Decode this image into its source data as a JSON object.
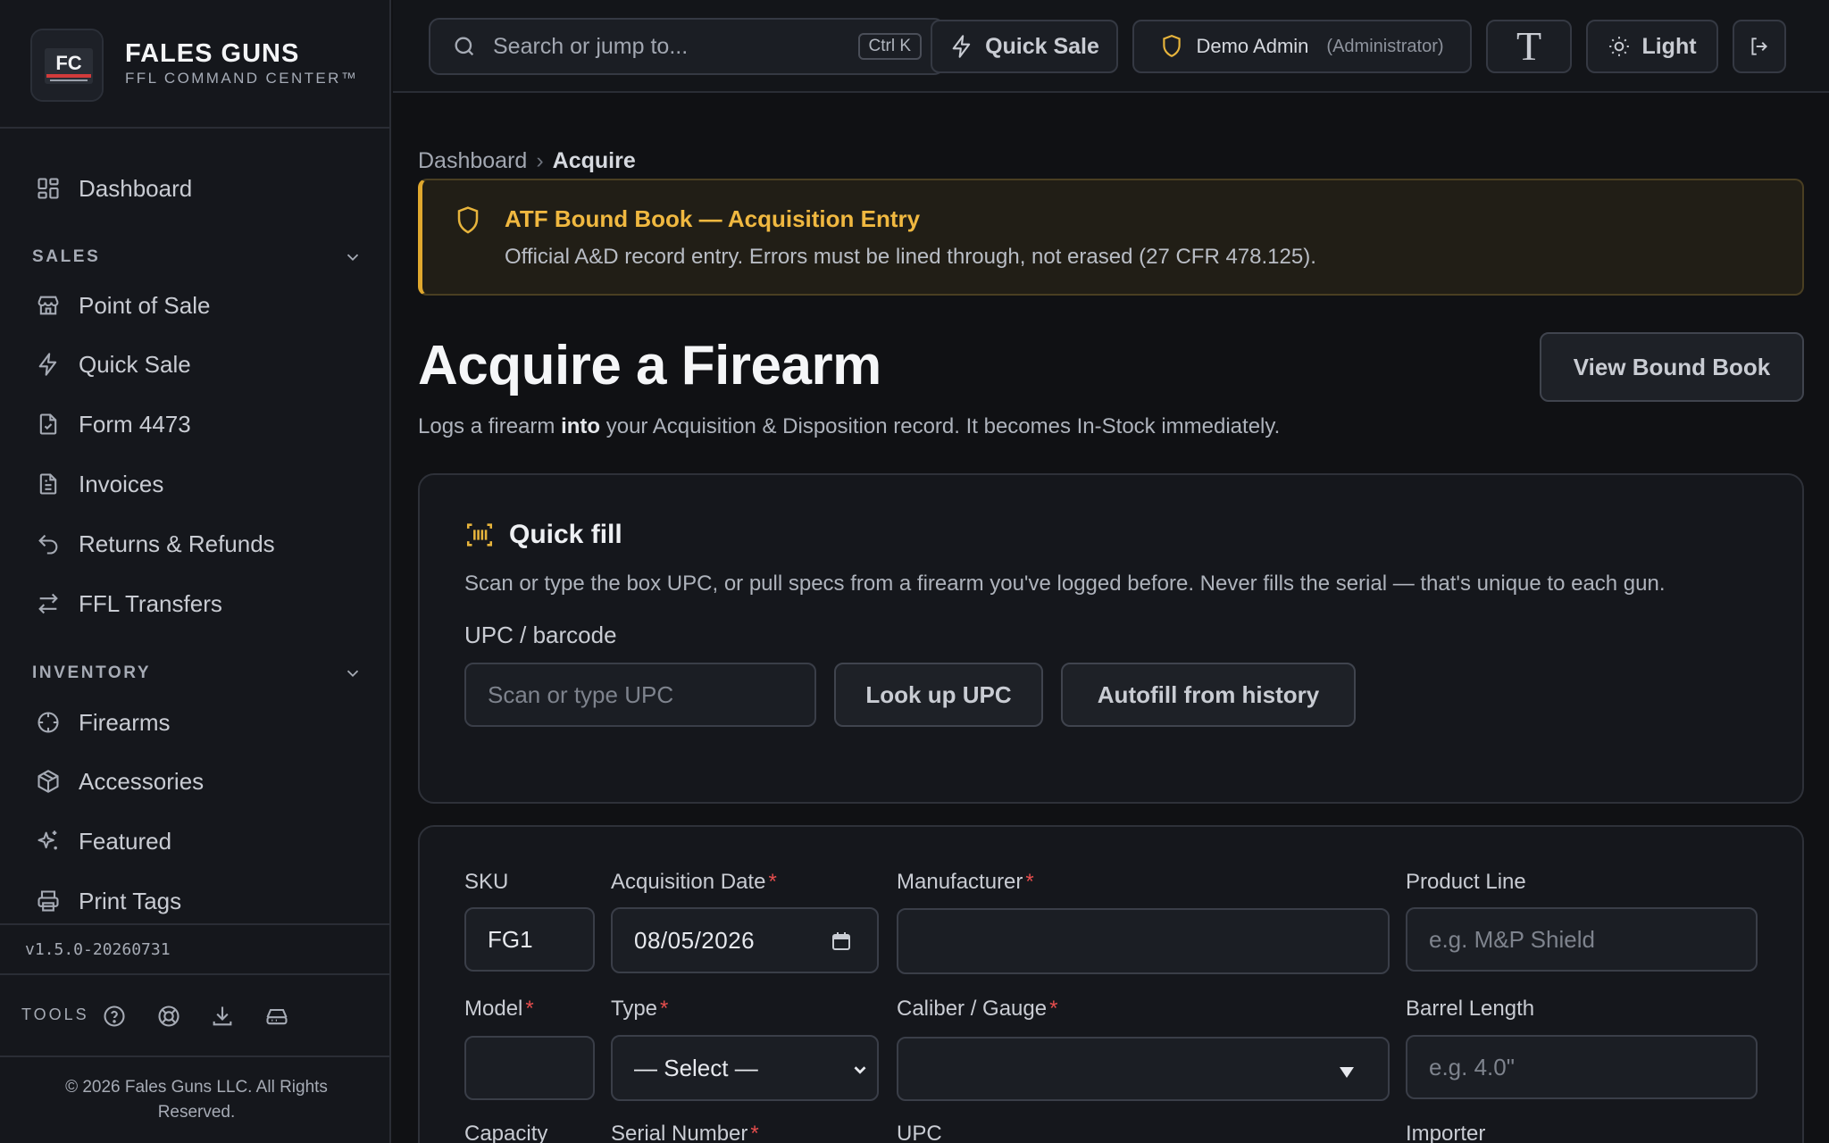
{
  "brand": {
    "title": "FALES GUNS",
    "subtitle": "FFL COMMAND CENTER™",
    "logo_text": "FC"
  },
  "sidebar": {
    "dashboard": "Dashboard",
    "sections": [
      {
        "label": "SALES",
        "items": [
          "Point of Sale",
          "Quick Sale",
          "Form 4473",
          "Invoices",
          "Returns & Refunds",
          "FFL Transfers"
        ]
      },
      {
        "label": "INVENTORY",
        "items": [
          "Firearms",
          "Accessories",
          "Featured",
          "Print Tags"
        ]
      }
    ],
    "version": "v1.5.0-20260731",
    "tools_label": "TOOLS",
    "copyright": "© 2026 Fales Guns LLC. All Rights Reserved."
  },
  "topbar": {
    "search_placeholder": "Search or jump to...",
    "search_shortcut": "Ctrl K",
    "quick_sale": "Quick Sale",
    "user_name": "Demo Admin",
    "user_role": "(Administrator)",
    "font_toggle": "T",
    "theme": "Light"
  },
  "breadcrumb": {
    "root": "Dashboard",
    "separator": "›",
    "current": "Acquire"
  },
  "notice": {
    "title": "ATF Bound Book — Acquisition Entry",
    "body": "Official A&D record entry. Errors must be lined through, not erased (27 CFR 478.125)."
  },
  "page": {
    "title": "Acquire a Firearm",
    "subtitle_pre": "Logs a firearm ",
    "subtitle_bold": "into",
    "subtitle_post": " your Acquisition & Disposition record. It becomes In-Stock immediately.",
    "view_bound_book": "View Bound Book"
  },
  "quick_fill": {
    "title": "Quick fill",
    "description": "Scan or type the box UPC, or pull specs from a firearm you've logged before. Never fills the serial — that's unique to each gun.",
    "upc_label": "UPC / barcode",
    "upc_placeholder": "Scan or type UPC",
    "lookup_button": "Look up UPC",
    "autofill_button": "Autofill from history"
  },
  "form": {
    "sku_label": "SKU",
    "sku_value": "FG1",
    "acq_date_label": "Acquisition Date",
    "acq_date_value": "08/05/2026",
    "manufacturer_label": "Manufacturer",
    "manufacturer_value": "",
    "product_line_label": "Product Line",
    "product_line_placeholder": "e.g. M&P Shield",
    "model_label": "Model",
    "model_value": "",
    "type_label": "Type",
    "type_value": "— Select —",
    "caliber_label": "Caliber / Gauge",
    "caliber_value": "",
    "barrel_label": "Barrel Length",
    "barrel_placeholder": "e.g. 4.0\"",
    "capacity_label": "Capacity",
    "serial_label": "Serial Number",
    "upc_label": "UPC",
    "importer_label": "Importer",
    "required_mark": "*"
  },
  "colors": {
    "accent": "#e7b43c",
    "required": "#e44d4d",
    "background": "#101114",
    "panel": "#15171c"
  }
}
